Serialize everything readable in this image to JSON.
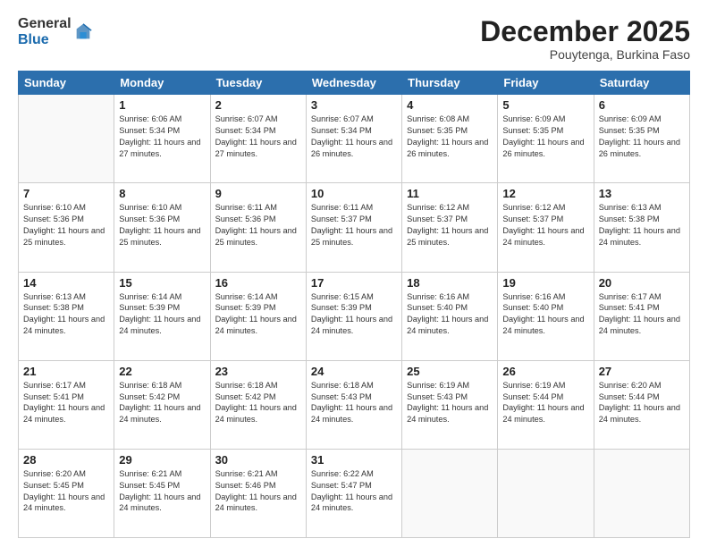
{
  "logo": {
    "general": "General",
    "blue": "Blue"
  },
  "header": {
    "month": "December 2025",
    "location": "Pouytenga, Burkina Faso"
  },
  "days_of_week": [
    "Sunday",
    "Monday",
    "Tuesday",
    "Wednesday",
    "Thursday",
    "Friday",
    "Saturday"
  ],
  "weeks": [
    [
      {
        "day": "",
        "sunrise": "",
        "sunset": "",
        "daylight": ""
      },
      {
        "day": "1",
        "sunrise": "Sunrise: 6:06 AM",
        "sunset": "Sunset: 5:34 PM",
        "daylight": "Daylight: 11 hours and 27 minutes."
      },
      {
        "day": "2",
        "sunrise": "Sunrise: 6:07 AM",
        "sunset": "Sunset: 5:34 PM",
        "daylight": "Daylight: 11 hours and 27 minutes."
      },
      {
        "day": "3",
        "sunrise": "Sunrise: 6:07 AM",
        "sunset": "Sunset: 5:34 PM",
        "daylight": "Daylight: 11 hours and 26 minutes."
      },
      {
        "day": "4",
        "sunrise": "Sunrise: 6:08 AM",
        "sunset": "Sunset: 5:35 PM",
        "daylight": "Daylight: 11 hours and 26 minutes."
      },
      {
        "day": "5",
        "sunrise": "Sunrise: 6:09 AM",
        "sunset": "Sunset: 5:35 PM",
        "daylight": "Daylight: 11 hours and 26 minutes."
      },
      {
        "day": "6",
        "sunrise": "Sunrise: 6:09 AM",
        "sunset": "Sunset: 5:35 PM",
        "daylight": "Daylight: 11 hours and 26 minutes."
      }
    ],
    [
      {
        "day": "7",
        "sunrise": "Sunrise: 6:10 AM",
        "sunset": "Sunset: 5:36 PM",
        "daylight": "Daylight: 11 hours and 25 minutes."
      },
      {
        "day": "8",
        "sunrise": "Sunrise: 6:10 AM",
        "sunset": "Sunset: 5:36 PM",
        "daylight": "Daylight: 11 hours and 25 minutes."
      },
      {
        "day": "9",
        "sunrise": "Sunrise: 6:11 AM",
        "sunset": "Sunset: 5:36 PM",
        "daylight": "Daylight: 11 hours and 25 minutes."
      },
      {
        "day": "10",
        "sunrise": "Sunrise: 6:11 AM",
        "sunset": "Sunset: 5:37 PM",
        "daylight": "Daylight: 11 hours and 25 minutes."
      },
      {
        "day": "11",
        "sunrise": "Sunrise: 6:12 AM",
        "sunset": "Sunset: 5:37 PM",
        "daylight": "Daylight: 11 hours and 25 minutes."
      },
      {
        "day": "12",
        "sunrise": "Sunrise: 6:12 AM",
        "sunset": "Sunset: 5:37 PM",
        "daylight": "Daylight: 11 hours and 24 minutes."
      },
      {
        "day": "13",
        "sunrise": "Sunrise: 6:13 AM",
        "sunset": "Sunset: 5:38 PM",
        "daylight": "Daylight: 11 hours and 24 minutes."
      }
    ],
    [
      {
        "day": "14",
        "sunrise": "Sunrise: 6:13 AM",
        "sunset": "Sunset: 5:38 PM",
        "daylight": "Daylight: 11 hours and 24 minutes."
      },
      {
        "day": "15",
        "sunrise": "Sunrise: 6:14 AM",
        "sunset": "Sunset: 5:39 PM",
        "daylight": "Daylight: 11 hours and 24 minutes."
      },
      {
        "day": "16",
        "sunrise": "Sunrise: 6:14 AM",
        "sunset": "Sunset: 5:39 PM",
        "daylight": "Daylight: 11 hours and 24 minutes."
      },
      {
        "day": "17",
        "sunrise": "Sunrise: 6:15 AM",
        "sunset": "Sunset: 5:39 PM",
        "daylight": "Daylight: 11 hours and 24 minutes."
      },
      {
        "day": "18",
        "sunrise": "Sunrise: 6:16 AM",
        "sunset": "Sunset: 5:40 PM",
        "daylight": "Daylight: 11 hours and 24 minutes."
      },
      {
        "day": "19",
        "sunrise": "Sunrise: 6:16 AM",
        "sunset": "Sunset: 5:40 PM",
        "daylight": "Daylight: 11 hours and 24 minutes."
      },
      {
        "day": "20",
        "sunrise": "Sunrise: 6:17 AM",
        "sunset": "Sunset: 5:41 PM",
        "daylight": "Daylight: 11 hours and 24 minutes."
      }
    ],
    [
      {
        "day": "21",
        "sunrise": "Sunrise: 6:17 AM",
        "sunset": "Sunset: 5:41 PM",
        "daylight": "Daylight: 11 hours and 24 minutes."
      },
      {
        "day": "22",
        "sunrise": "Sunrise: 6:18 AM",
        "sunset": "Sunset: 5:42 PM",
        "daylight": "Daylight: 11 hours and 24 minutes."
      },
      {
        "day": "23",
        "sunrise": "Sunrise: 6:18 AM",
        "sunset": "Sunset: 5:42 PM",
        "daylight": "Daylight: 11 hours and 24 minutes."
      },
      {
        "day": "24",
        "sunrise": "Sunrise: 6:18 AM",
        "sunset": "Sunset: 5:43 PM",
        "daylight": "Daylight: 11 hours and 24 minutes."
      },
      {
        "day": "25",
        "sunrise": "Sunrise: 6:19 AM",
        "sunset": "Sunset: 5:43 PM",
        "daylight": "Daylight: 11 hours and 24 minutes."
      },
      {
        "day": "26",
        "sunrise": "Sunrise: 6:19 AM",
        "sunset": "Sunset: 5:44 PM",
        "daylight": "Daylight: 11 hours and 24 minutes."
      },
      {
        "day": "27",
        "sunrise": "Sunrise: 6:20 AM",
        "sunset": "Sunset: 5:44 PM",
        "daylight": "Daylight: 11 hours and 24 minutes."
      }
    ],
    [
      {
        "day": "28",
        "sunrise": "Sunrise: 6:20 AM",
        "sunset": "Sunset: 5:45 PM",
        "daylight": "Daylight: 11 hours and 24 minutes."
      },
      {
        "day": "29",
        "sunrise": "Sunrise: 6:21 AM",
        "sunset": "Sunset: 5:45 PM",
        "daylight": "Daylight: 11 hours and 24 minutes."
      },
      {
        "day": "30",
        "sunrise": "Sunrise: 6:21 AM",
        "sunset": "Sunset: 5:46 PM",
        "daylight": "Daylight: 11 hours and 24 minutes."
      },
      {
        "day": "31",
        "sunrise": "Sunrise: 6:22 AM",
        "sunset": "Sunset: 5:47 PM",
        "daylight": "Daylight: 11 hours and 24 minutes."
      },
      {
        "day": "",
        "sunrise": "",
        "sunset": "",
        "daylight": ""
      },
      {
        "day": "",
        "sunrise": "",
        "sunset": "",
        "daylight": ""
      },
      {
        "day": "",
        "sunrise": "",
        "sunset": "",
        "daylight": ""
      }
    ]
  ]
}
